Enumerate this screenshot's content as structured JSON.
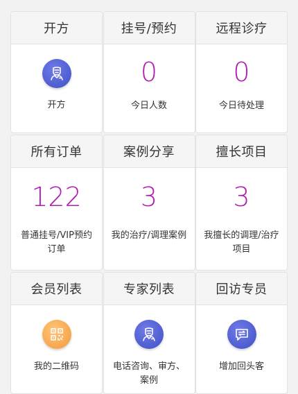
{
  "cards": [
    {
      "title": "开方",
      "icon": "doctor-icon",
      "desc": "开方"
    },
    {
      "title": "挂号/预约",
      "value": "0",
      "desc": "今日人数"
    },
    {
      "title": "远程诊疗",
      "value": "0",
      "desc": "今日待处理"
    },
    {
      "title": "所有订单",
      "value": "122",
      "desc": "普通挂号/VIP预约订单"
    },
    {
      "title": "案例分享",
      "value": "3",
      "desc": "我的治疗/调理案例"
    },
    {
      "title": "擅长项目",
      "value": "3",
      "desc": "我擅长的调理/治疗项目"
    },
    {
      "title": "会员列表",
      "icon": "qr-code-icon",
      "desc": "我的二维码"
    },
    {
      "title": "专家列表",
      "icon": "doctor-icon",
      "desc": "电话咨询、审方、案例"
    },
    {
      "title": "回访专员",
      "icon": "message-icon",
      "desc": "增加回头客"
    }
  ],
  "colors": {
    "accent_number": "#b21bb3",
    "icon_blue": "#4a58cf",
    "icon_orange": "#f4a84e"
  }
}
